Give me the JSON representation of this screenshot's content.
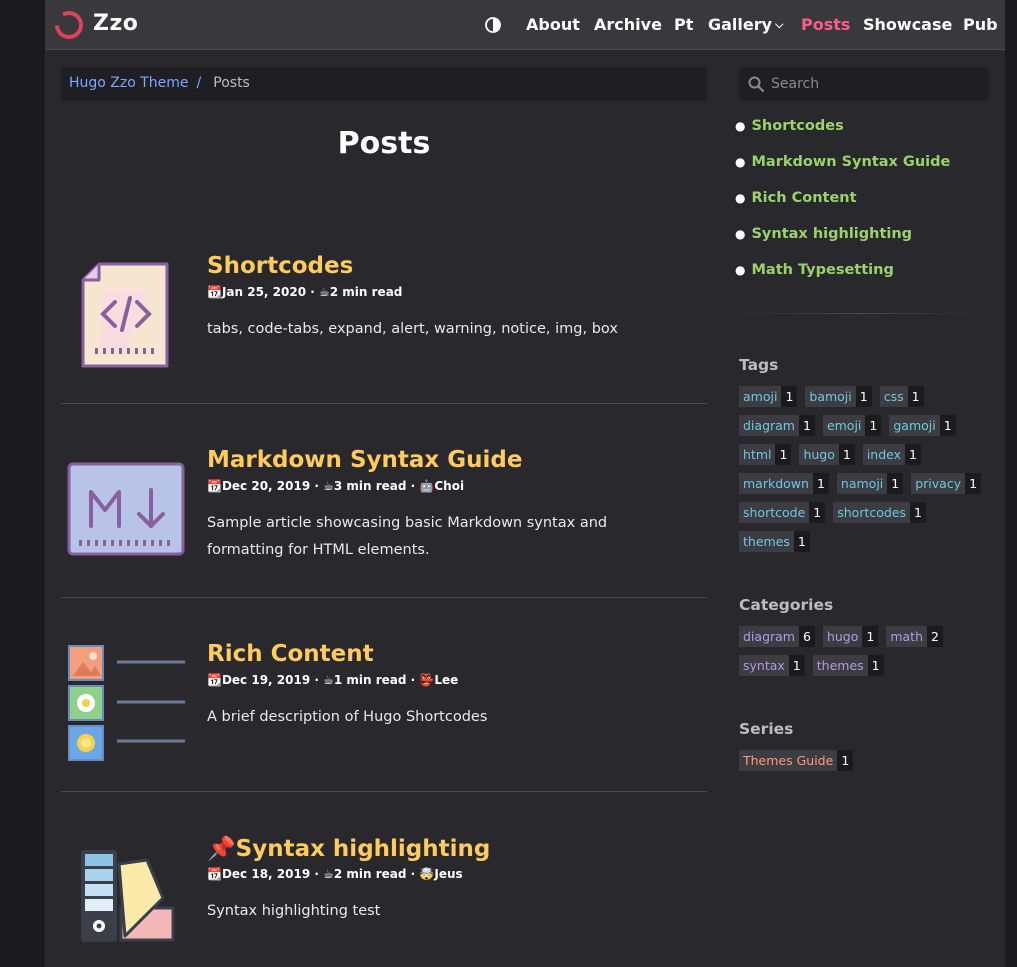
{
  "navbar": {
    "brand": "Zzo",
    "items": [
      {
        "label": "About",
        "active": false
      },
      {
        "label": "Archive",
        "active": false
      },
      {
        "label": "Pt",
        "active": false
      },
      {
        "label": "Gallery",
        "active": false,
        "dropdown": true
      },
      {
        "label": "Posts",
        "active": true
      },
      {
        "label": "Showcase",
        "active": false
      },
      {
        "label": "Pub",
        "active": false
      }
    ],
    "theme_toggle_icon": "contrast-icon",
    "accent_color": "#ff5c8a"
  },
  "breadcrumb": {
    "home": "Hugo Zzo Theme",
    "separator": "/",
    "current": "Posts"
  },
  "search": {
    "placeholder": "Search"
  },
  "page_title": "Posts",
  "posts": [
    {
      "title": "Shortcodes",
      "pin": "",
      "date": "Jan 25, 2020",
      "read": "2 min read",
      "author": "",
      "description": "tabs, code-tabs, expand, alert, warning, notice, img, box",
      "thumbnail": "code-file-icon"
    },
    {
      "title": "Markdown Syntax Guide",
      "pin": "",
      "date": "Dec 20, 2019",
      "read": "3 min read",
      "author": "Choi",
      "description": "Sample article showcasing basic Markdown syntax and formatting for HTML elements.",
      "thumbnail": "markdown-icon"
    },
    {
      "title": "Rich Content",
      "pin": "",
      "date": "Dec 19, 2019",
      "read": "1 min read",
      "author": "Lee",
      "description": "A brief description of Hugo Shortcodes",
      "thumbnail": "image-gallery-icon"
    },
    {
      "title": "Syntax highlighting",
      "pin": "📌",
      "date": "Dec 18, 2019",
      "read": "2 min read",
      "author": "Jeus",
      "description": "Syntax highlighting test",
      "thumbnail": "color-palette-icon"
    }
  ],
  "toc": [
    "Shortcodes",
    "Markdown Syntax Guide",
    "Rich Content",
    "Syntax highlighting",
    "Math Typesetting"
  ],
  "tags": {
    "heading": "Tags",
    "rows": [
      [
        {
          "name": "amoji",
          "count": "1"
        },
        {
          "name": "bamoji",
          "count": "1"
        },
        {
          "name": "css",
          "count": "1"
        }
      ],
      [
        {
          "name": "diagram",
          "count": "1"
        },
        {
          "name": "emoji",
          "count": "1"
        },
        {
          "name": "gamoji",
          "count": "1"
        }
      ],
      [
        {
          "name": "html",
          "count": "1"
        },
        {
          "name": "hugo",
          "count": "1"
        },
        {
          "name": "index",
          "count": "1"
        }
      ],
      [
        {
          "name": "markdown",
          "count": "1"
        },
        {
          "name": "namoji",
          "count": "1"
        },
        {
          "name": "privacy",
          "count": "1"
        }
      ],
      [
        {
          "name": "shortcode",
          "count": "1"
        },
        {
          "name": "shortcodes",
          "count": "1"
        }
      ],
      [
        {
          "name": "themes",
          "count": "1"
        }
      ]
    ]
  },
  "categories": {
    "heading": "Categories",
    "rows": [
      [
        {
          "name": "diagram",
          "count": "6"
        },
        {
          "name": "hugo",
          "count": "1"
        },
        {
          "name": "math",
          "count": "2"
        }
      ],
      [
        {
          "name": "syntax",
          "count": "1"
        },
        {
          "name": "themes",
          "count": "1"
        }
      ]
    ]
  },
  "series": {
    "heading": "Series",
    "rows": [
      [
        {
          "name": "Themes Guide",
          "count": "1"
        }
      ]
    ]
  },
  "meta_icons": {
    "date": "📆",
    "read": "☕",
    "author_choi": "🤖",
    "author_lee": "👺",
    "author_jeus": "🤯"
  }
}
